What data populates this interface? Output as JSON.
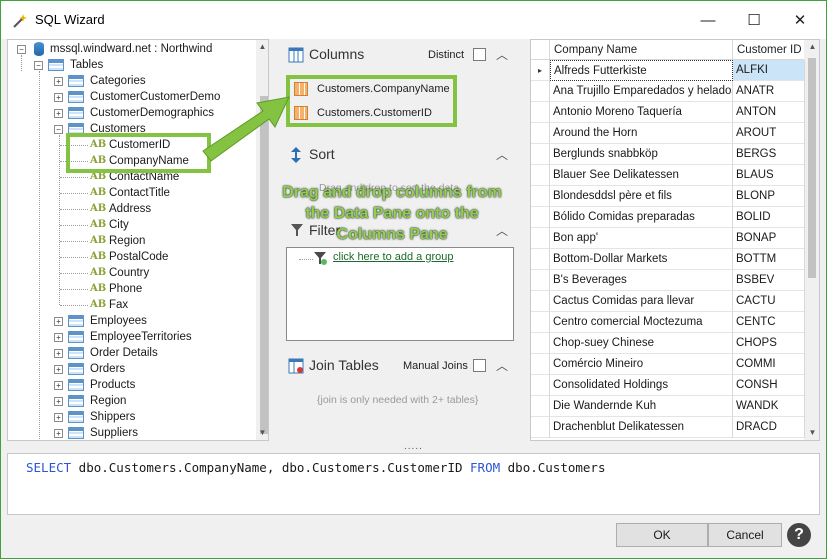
{
  "window": {
    "title": "SQL Wizard",
    "controls": {
      "minimize": "—",
      "maximize": "☐",
      "close": "✕"
    }
  },
  "tree": {
    "root": "mssql.windward.net : Northwind",
    "tables_label": "Tables",
    "tables_before": [
      "Categories",
      "CustomerCustomerDemo",
      "CustomerDemographics"
    ],
    "customers_label": "Customers",
    "customer_fields": [
      "CustomerID",
      "CompanyName",
      "ContactName",
      "ContactTitle",
      "Address",
      "City",
      "Region",
      "PostalCode",
      "Country",
      "Phone",
      "Fax"
    ],
    "tables_after": [
      "Employees",
      "EmployeeTerritories",
      "Order Details",
      "Orders",
      "Products",
      "Region",
      "Shippers",
      "Suppliers"
    ],
    "field_icon_text": "AB"
  },
  "columns_pane": {
    "title": "Columns",
    "distinct_label": "Distinct",
    "items": [
      "Customers.CompanyName",
      "Customers.CustomerID"
    ]
  },
  "sort_pane": {
    "title": "Sort",
    "hint": "Drag and drop to sort the data"
  },
  "filter_pane": {
    "title": "Filter",
    "add_group_link": "click here to add a group"
  },
  "join_pane": {
    "title": "Join Tables",
    "manual_joins_label": "Manual Joins",
    "hint": "{join is only needed with 2+ tables}"
  },
  "overlay": {
    "line1": "Drag and drop columns from",
    "line2": "the Data Pane onto the",
    "line3": "Columns Pane"
  },
  "grid": {
    "headers": [
      "Company Name",
      "Customer ID"
    ],
    "rows": [
      [
        "Alfreds Futterkiste",
        "ALFKI"
      ],
      [
        "Ana Trujillo Emparedados y helados",
        "ANATR"
      ],
      [
        "Antonio Moreno Taquería",
        "ANTON"
      ],
      [
        "Around the Horn",
        "AROUT"
      ],
      [
        "Berglunds snabbköp",
        "BERGS"
      ],
      [
        "Blauer See Delikatessen",
        "BLAUS"
      ],
      [
        "Blondesddsl père et fils",
        "BLONP"
      ],
      [
        "Bólido Comidas preparadas",
        "BOLID"
      ],
      [
        "Bon app'",
        "BONAP"
      ],
      [
        "Bottom-Dollar Markets",
        "BOTTM"
      ],
      [
        "B's Beverages",
        "BSBEV"
      ],
      [
        "Cactus Comidas para llevar",
        "CACTU"
      ],
      [
        "Centro comercial Moctezuma",
        "CENTC"
      ],
      [
        "Chop-suey Chinese",
        "CHOPS"
      ],
      [
        "Comércio Mineiro",
        "COMMI"
      ],
      [
        "Consolidated Holdings",
        "CONSH"
      ],
      [
        "Die Wandernde Kuh",
        "WANDK"
      ],
      [
        "Drachenblut Delikatessen",
        "DRACD"
      ]
    ]
  },
  "sql": {
    "kw_select": "SELECT",
    "select_list": " dbo.Customers.CompanyName, dbo.Customers.CustomerID ",
    "kw_from": "FROM",
    "from_table": " dbo.Customers"
  },
  "splitter": ".....",
  "buttons": {
    "ok": "OK",
    "cancel": "Cancel",
    "help": "?"
  },
  "colors": {
    "accent_green": "#84c341",
    "keyword_blue": "#2a55d6",
    "link_green": "#1d6b2a"
  }
}
